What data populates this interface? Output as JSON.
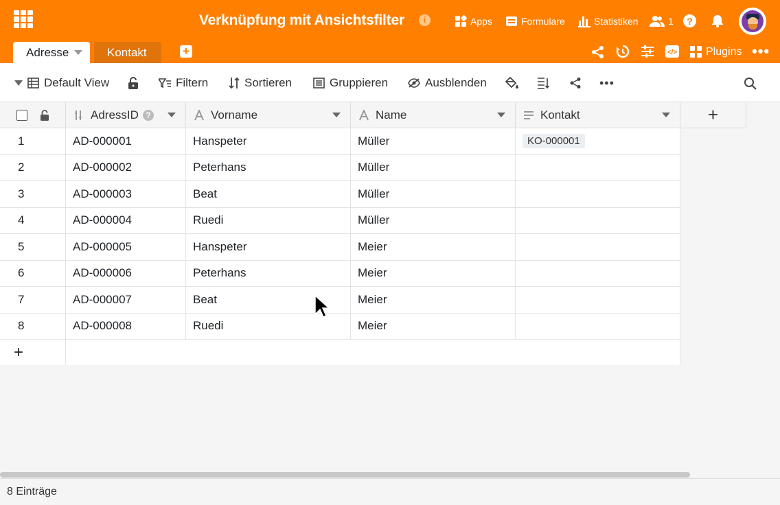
{
  "header": {
    "title": "Verknüpfung mit Ansichtsfilter",
    "info_icon": "i",
    "nav": {
      "apps": "Apps",
      "forms": "Formulare",
      "stats": "Statistiken",
      "collaborators_count": "1"
    },
    "plugins_label": "Plugins"
  },
  "tabs": [
    {
      "label": "Adresse",
      "active": true
    },
    {
      "label": "Kontakt",
      "active": false
    }
  ],
  "toolbar": {
    "view_name": "Default View",
    "filter": "Filtern",
    "sort": "Sortieren",
    "group": "Gruppieren",
    "hide": "Ausblenden"
  },
  "columns": [
    {
      "name": "AdressID",
      "icon": "auto-number-icon"
    },
    {
      "name": "Vorname",
      "icon": "text-icon"
    },
    {
      "name": "Name",
      "icon": "text-icon"
    },
    {
      "name": "Kontakt",
      "icon": "link-icon"
    }
  ],
  "rows": [
    {
      "n": "1",
      "id": "AD-000001",
      "vorname": "Hanspeter",
      "name": "Müller",
      "kontakt": "KO-000001"
    },
    {
      "n": "2",
      "id": "AD-000002",
      "vorname": "Peterhans",
      "name": "Müller",
      "kontakt": ""
    },
    {
      "n": "3",
      "id": "AD-000003",
      "vorname": "Beat",
      "name": "Müller",
      "kontakt": ""
    },
    {
      "n": "4",
      "id": "AD-000004",
      "vorname": "Ruedi",
      "name": "Müller",
      "kontakt": ""
    },
    {
      "n": "5",
      "id": "AD-000005",
      "vorname": "Hanspeter",
      "name": "Meier",
      "kontakt": ""
    },
    {
      "n": "6",
      "id": "AD-000006",
      "vorname": "Peterhans",
      "name": "Meier",
      "kontakt": ""
    },
    {
      "n": "7",
      "id": "AD-000007",
      "vorname": "Beat",
      "name": "Meier",
      "kontakt": ""
    },
    {
      "n": "8",
      "id": "AD-000008",
      "vorname": "Ruedi",
      "name": "Meier",
      "kontakt": ""
    }
  ],
  "footer": {
    "count_label": "8 Einträge"
  },
  "colors": {
    "brand": "#ff8000",
    "tab_inactive": "#e0740a"
  }
}
